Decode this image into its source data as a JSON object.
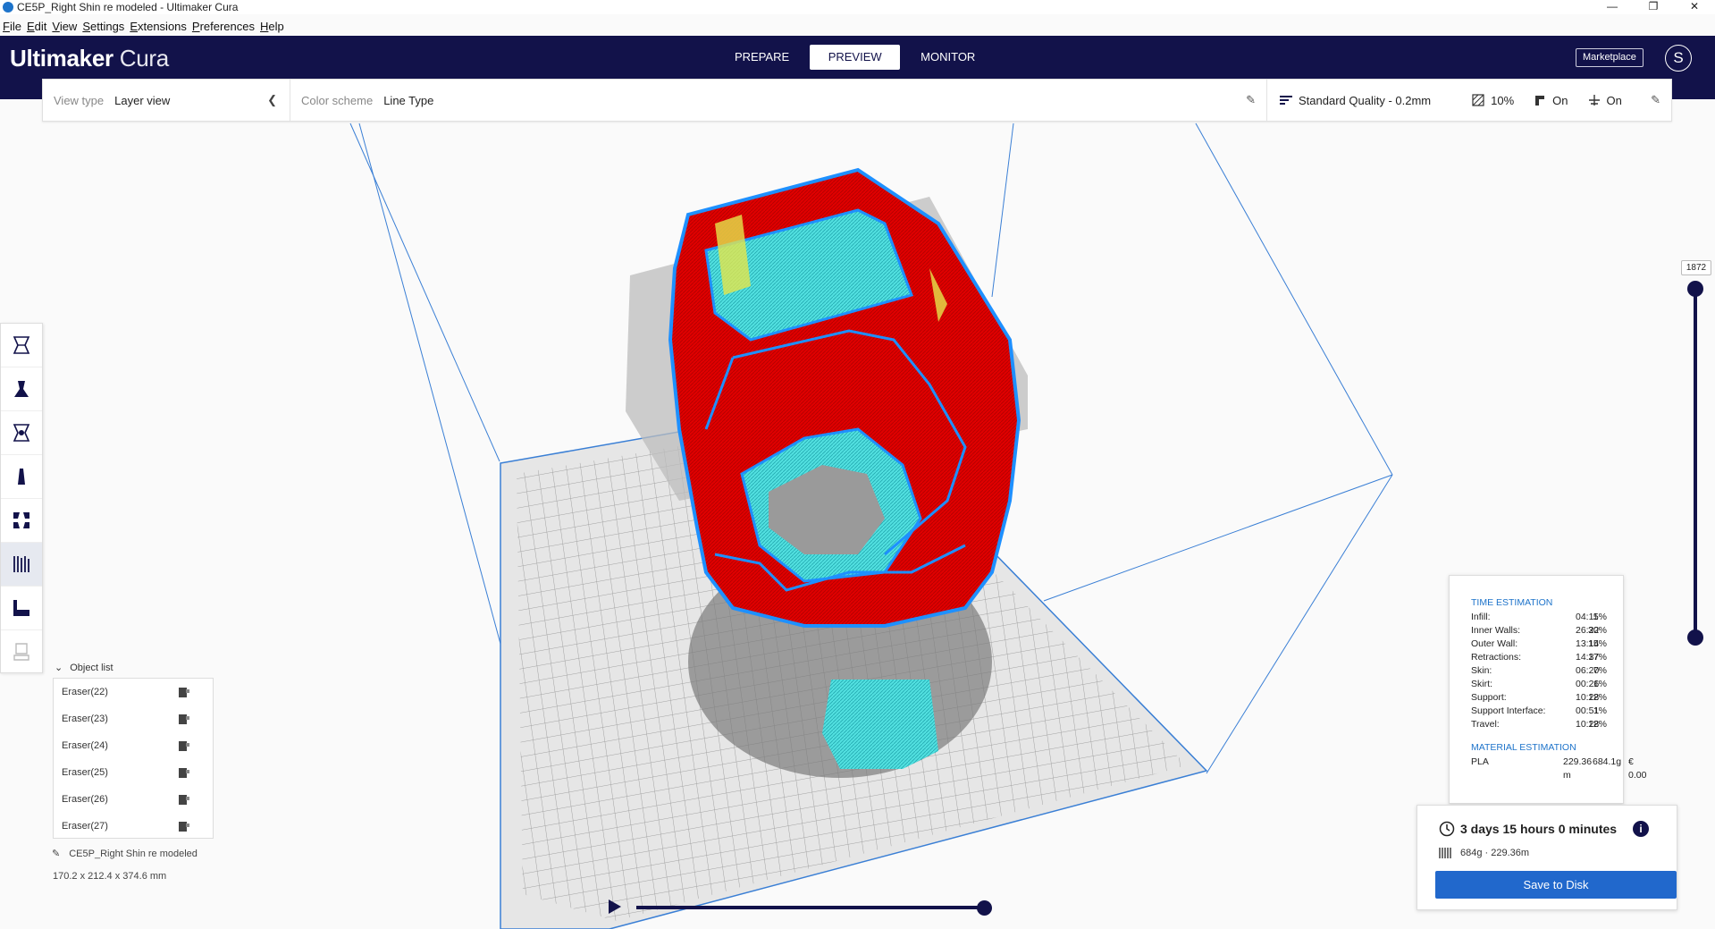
{
  "window": {
    "title": "CE5P_Right Shin re modeled - Ultimaker Cura",
    "controls": [
      "—",
      "❐",
      "✕"
    ]
  },
  "menu": [
    "File",
    "Edit",
    "View",
    "Settings",
    "Extensions",
    "Preferences",
    "Help"
  ],
  "header": {
    "logo_bold": "Ultimaker",
    "logo_light": " Cura",
    "tabs": [
      {
        "label": "PREPARE"
      },
      {
        "label": "PREVIEW",
        "active": true
      },
      {
        "label": "MONITOR"
      }
    ],
    "marketplace_label": "Marketplace",
    "avatar_initial": "S"
  },
  "view_bar": {
    "view_type_label": "View type",
    "view_type_value": "Layer view",
    "color_scheme_label": "Color scheme",
    "color_scheme_value": "Line Type",
    "quality": "Standard Quality - 0.2mm",
    "infill": "10%",
    "support": "On",
    "adhesion": "On"
  },
  "tools": [
    "move-tool",
    "scale-tool",
    "rotate-tool",
    "mirror-tool",
    "per-model-settings-tool",
    "support-blocker-tool",
    "layer-tool",
    "eraser-tool"
  ],
  "object_list": {
    "header": "Object list",
    "items": [
      {
        "label": "Eraser(22)"
      },
      {
        "label": "Eraser(23)"
      },
      {
        "label": "Eraser(24)"
      },
      {
        "label": "Eraser(25)"
      },
      {
        "label": "Eraser(26)"
      },
      {
        "label": "Eraser(27)"
      }
    ],
    "model_name": "CE5P_Right Shin re modeled",
    "dimensions": "170.2 x 212.4 x 374.6 mm"
  },
  "layer_slider": {
    "current_layer": "1872"
  },
  "estimate": {
    "time_header": "TIME ESTIMATION",
    "rows": [
      {
        "name": "Infill:",
        "time": "04:11",
        "pct": "5%"
      },
      {
        "name": "Inner Walls:",
        "time": "26:22",
        "pct": "30%"
      },
      {
        "name": "Outer Wall:",
        "time": "13:14",
        "pct": "15%"
      },
      {
        "name": "Retractions:",
        "time": "14:37",
        "pct": "17%"
      },
      {
        "name": "Skin:",
        "time": "06:20",
        "pct": "7%"
      },
      {
        "name": "Skirt:",
        "time": "00:26",
        "pct": "1%"
      },
      {
        "name": "Support:",
        "time": "10:28",
        "pct": "12%"
      },
      {
        "name": "Support Interface:",
        "time": "00:51",
        "pct": "1%"
      },
      {
        "name": "Travel:",
        "time": "10:28",
        "pct": "12%"
      }
    ],
    "material_header": "MATERIAL ESTIMATION",
    "material": {
      "name": "PLA",
      "length": "229.36 m",
      "weight": "684.1g",
      "cost": "€ 0.00"
    }
  },
  "action": {
    "print_time": "3 days 15 hours 0 minutes",
    "usage": "684g · 229.36m",
    "save_label": "Save to Disk"
  },
  "colors": {
    "header": "#12124a",
    "accent": "#2168cc",
    "model_outer": "#e00000",
    "support": "#3dd6d6",
    "wall_outline": "#1e90ff"
  }
}
